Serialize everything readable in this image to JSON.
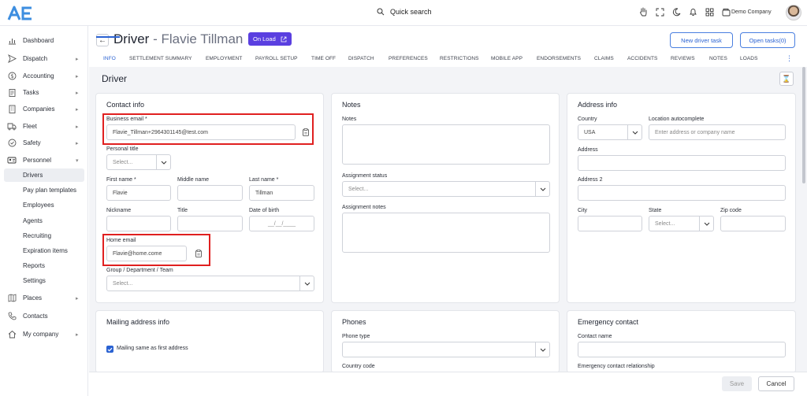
{
  "topbar": {
    "logo": "AE",
    "search_label": "Quick search",
    "company": "Demo Company",
    "icons": [
      "hand-icon",
      "fullscreen-icon",
      "moon-icon",
      "bell-icon",
      "apps-grid-icon",
      "wallet-icon"
    ]
  },
  "sidebar": {
    "items": [
      {
        "label": "Dashboard",
        "icon": "chart-icon"
      },
      {
        "label": "Dispatch",
        "icon": "send-icon"
      },
      {
        "label": "Accounting",
        "icon": "dollar-icon"
      },
      {
        "label": "Tasks",
        "icon": "clipboard-icon"
      },
      {
        "label": "Companies",
        "icon": "building-icon"
      },
      {
        "label": "Fleet",
        "icon": "truck-icon"
      },
      {
        "label": "Safety",
        "icon": "shield-check-icon"
      },
      {
        "label": "Personnel",
        "icon": "id-card-icon"
      }
    ],
    "personnel_sub": [
      "Drivers",
      "Pay plan templates",
      "Employees",
      "Agents",
      "Recruiting",
      "Expiration items",
      "Reports",
      "Settings"
    ],
    "bottom_items": [
      {
        "label": "Places",
        "icon": "map-icon"
      },
      {
        "label": "Contacts",
        "icon": "phone-icon"
      },
      {
        "label": "My company",
        "icon": "home-icon"
      }
    ]
  },
  "header": {
    "title_prefix": "Driver",
    "title_name": " - Flavie Tillman",
    "status_badge": "On Load",
    "new_task_button": "New driver task",
    "open_tasks_button": "Open tasks(0)",
    "tabs": [
      "INFO",
      "SETTLEMENT SUMMARY",
      "EMPLOYMENT",
      "PAYROLL SETUP",
      "TIME OFF",
      "DISPATCH",
      "PREFERENCES",
      "RESTRICTIONS",
      "MOBILE APP",
      "ENDORSEMENTS",
      "CLAIMS",
      "ACCIDENTS",
      "REVIEWS",
      "NOTES",
      "LOADS"
    ],
    "active_tab": "INFO"
  },
  "section_title": "Driver",
  "contact_info": {
    "title": "Contact info",
    "business_email_label": "Business email *",
    "business_email": "Flavie_Tillman+2964301145@test.com",
    "personal_title_label": "Personal title",
    "personal_title_value": "Select...",
    "first_name_label": "First name *",
    "first_name": "Flavie",
    "middle_name_label": "Middle name",
    "last_name_label": "Last name *",
    "last_name": "Tillman",
    "nickname_label": "Nickname",
    "title_label": "Title",
    "dob_label": "Date of birth",
    "dob_placeholder": "__/__/____",
    "home_email_label": "Home email",
    "home_email": "Flavie@home.come",
    "group_label": "Group / Department / Team",
    "group_value": "Select..."
  },
  "notes": {
    "title": "Notes",
    "notes_label": "Notes",
    "assignment_status_label": "Assignment status",
    "assignment_status_value": "Select...",
    "assignment_notes_label": "Assignment notes"
  },
  "address": {
    "title": "Address info",
    "country_label": "Country",
    "country_value": "USA",
    "location_label": "Location autocomplete",
    "location_placeholder": "Enter address or company name",
    "address_label": "Address",
    "address2_label": "Address 2",
    "city_label": "City",
    "state_label": "State",
    "state_value": "Select...",
    "zip_label": "Zip code"
  },
  "mailing": {
    "title": "Mailing address info",
    "same_label": "Mailing same as first address"
  },
  "phones": {
    "title": "Phones",
    "phone_type_label": "Phone type",
    "country_code_label": "Country code"
  },
  "emergency": {
    "title": "Emergency contact",
    "contact_name_label": "Contact name",
    "relationship_label": "Emergency contact relationship"
  },
  "footer": {
    "save_label": "Save",
    "cancel_label": "Cancel"
  },
  "colors": {
    "accent": "#2a62d2",
    "badge": "#5a3fe0",
    "highlight": "#e02020"
  }
}
